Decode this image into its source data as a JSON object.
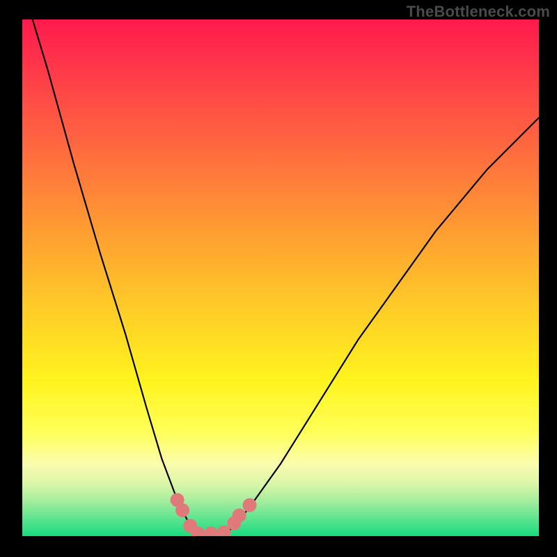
{
  "watermark": "TheBottleneck.com",
  "colors": {
    "frame": "#000000",
    "gradient_top": "#ff1a4d",
    "gradient_bottom": "#19db7f",
    "curve": "#000000",
    "marker": "#e07a7a"
  },
  "chart_data": {
    "type": "line",
    "title": "",
    "xlabel": "",
    "ylabel": "",
    "xlim": [
      0,
      100
    ],
    "ylim": [
      0,
      100
    ],
    "x": [
      2,
      5,
      10,
      15,
      20,
      24,
      27,
      30,
      32,
      33,
      34,
      35,
      37,
      40,
      42,
      45,
      50,
      55,
      60,
      65,
      70,
      75,
      80,
      85,
      90,
      95,
      100
    ],
    "y": [
      100,
      90,
      72,
      55,
      39,
      25,
      15,
      7,
      3,
      1,
      0,
      0,
      0,
      1,
      3,
      7,
      14,
      22,
      30,
      38,
      45,
      52,
      59,
      65,
      71,
      76,
      81
    ],
    "series": [
      {
        "name": "bottleneck_curve",
        "x": [
          2,
          5,
          10,
          15,
          20,
          24,
          27,
          30,
          32,
          33,
          34,
          35,
          37,
          40,
          42,
          45,
          50,
          55,
          60,
          65,
          70,
          75,
          80,
          85,
          90,
          95,
          100
        ],
        "y": [
          100,
          90,
          72,
          55,
          39,
          25,
          15,
          7,
          3,
          1,
          0,
          0,
          0,
          1,
          3,
          7,
          14,
          22,
          30,
          38,
          45,
          52,
          59,
          65,
          71,
          76,
          81
        ]
      }
    ],
    "markers": [
      {
        "x": 30,
        "y": 7
      },
      {
        "x": 31,
        "y": 5
      },
      {
        "x": 32.5,
        "y": 2
      },
      {
        "x": 34,
        "y": 0.5
      },
      {
        "x": 36.5,
        "y": 0.5
      },
      {
        "x": 39,
        "y": 0.7
      },
      {
        "x": 41,
        "y": 2.5
      },
      {
        "x": 42,
        "y": 4
      },
      {
        "x": 44,
        "y": 6
      }
    ],
    "annotations": []
  }
}
